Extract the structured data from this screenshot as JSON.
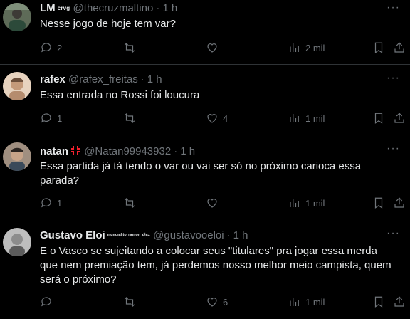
{
  "tweets": [
    {
      "name": "LM",
      "name_tag": "crvg",
      "handle": "@thecruzmaltino",
      "time": "1 h",
      "text": "Nesse jogo de hoje tem var?",
      "replies": "2",
      "retweets": "",
      "likes": "",
      "views": "2 mil",
      "avatar_color": "#6b7d6a"
    },
    {
      "name": "rafex",
      "name_tag": "",
      "handle": "@rafex_freitas",
      "time": "1 h",
      "text": "Essa entrada no Rossi foi loucura",
      "replies": "1",
      "retweets": "",
      "likes": "4",
      "views": "1 mil",
      "avatar_color": "#d6b59a"
    },
    {
      "name": "natan",
      "name_tag": "",
      "handle": "@Natan99943932",
      "time": "1 h",
      "text": "Essa partida já tá tendo o var ou vai ser só no próximo carioca essa parada?",
      "replies": "1",
      "retweets": "",
      "likes": "",
      "views": "1 mil",
      "avatar_color": "#8a7a6e",
      "emoji_color": "#f4212e"
    },
    {
      "name": "Gustavo Eloi",
      "name_tag": "ᵐᵘⁿᵈᶦᵃˡᶦᵗᵒ ʳᵃᵐᵒⁿ ᵈⁱᵃᶻ",
      "handle": "@gustavooeloi",
      "time": "1 h",
      "text": "E o Vasco se sujeitando a colocar seus \"titulares\" pra jogar essa merda que nem premiação tem, já perdemos nosso melhor meio campista, quem será o próximo?",
      "replies": "",
      "retweets": "",
      "likes": "6",
      "views": "1 mil",
      "avatar_color": "#9a9a9a"
    }
  ],
  "colors": {
    "background": "#000000",
    "text": "#e7e9ea",
    "muted": "#71767b",
    "divider": "#2f3336"
  },
  "icons": [
    "reply-icon",
    "retweet-icon",
    "like-icon",
    "views-icon",
    "bookmark-icon",
    "share-icon",
    "more-icon"
  ]
}
